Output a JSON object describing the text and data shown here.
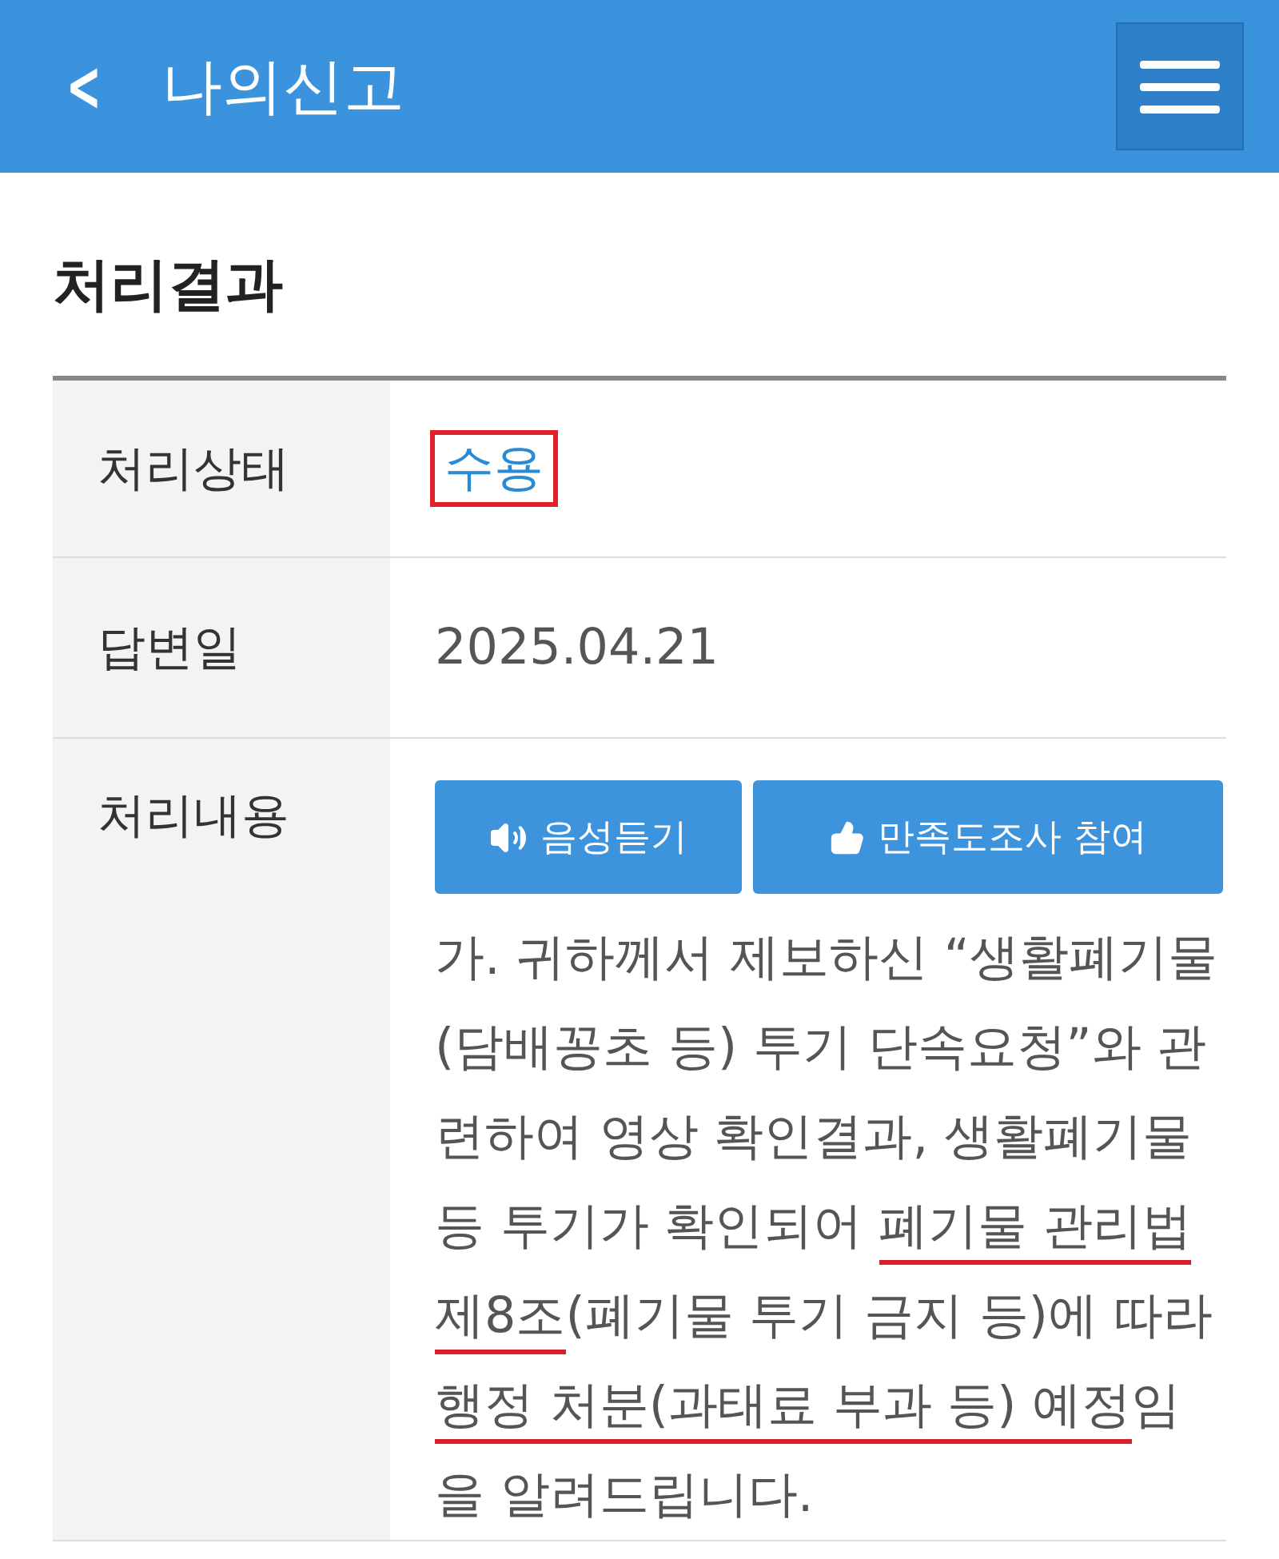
{
  "header": {
    "back": "<",
    "title": "나의신고"
  },
  "section_title": "처리결과",
  "rows": [
    {
      "label": "처리상태",
      "kind": "status",
      "value": "수용",
      "boxed": true
    },
    {
      "label": "답변일",
      "kind": "text",
      "value": "2025.04.21"
    },
    {
      "label": "처리내용",
      "kind": "content",
      "buttons": [
        {
          "label": "음성듣기"
        },
        {
          "label": "만족도조사 참여"
        }
      ],
      "segments": [
        {
          "text": "가. 귀하께서 제보하신 “생활폐기물(담배꽁초 등) 투기 단속요청”와 관련하여 영상 확인결과, 생활폐기물 등 투기가 확인되어 ",
          "underlined": false
        },
        {
          "text": "폐기물 관리법 제8조",
          "underlined": true
        },
        {
          "text": "(폐기물 투기 금지 등)에 따라 ",
          "underlined": false
        },
        {
          "text": "행정 처분(과태료 부과 등) 예정",
          "underlined": true
        },
        {
          "text": "임을 알려드립니다.",
          "underlined": false
        }
      ]
    }
  ]
}
